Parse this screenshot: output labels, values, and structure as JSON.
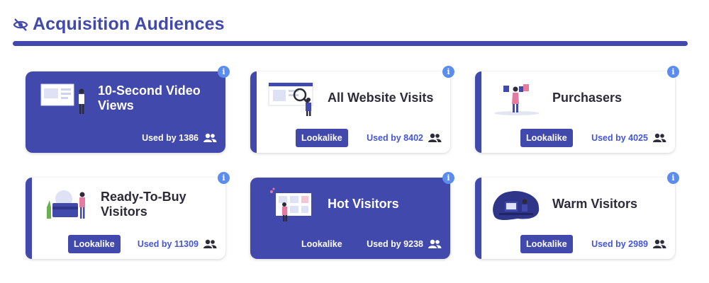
{
  "header": {
    "title": "Acquisition Audiences",
    "icon": "eye-slash-icon"
  },
  "colors": {
    "brand": "#4149ad",
    "accent": "#4455d6",
    "info": "#5b8df0"
  },
  "cards": [
    {
      "title": "10-Second Video Views",
      "lookalike": "",
      "used": "Used by 1386",
      "illustration": "video-views-illustration"
    },
    {
      "title": "All Website Visits",
      "lookalike": "Lookalike",
      "used": "Used by 8402",
      "illustration": "website-visits-illustration"
    },
    {
      "title": "Purchasers",
      "lookalike": "Lookalike",
      "used": "Used by 4025",
      "illustration": "purchasers-illustration"
    },
    {
      "title": "Ready-To-Buy Visitors",
      "lookalike": "Lookalike",
      "used": "Used by 11309",
      "illustration": "ready-to-buy-illustration"
    },
    {
      "title": "Hot Visitors",
      "lookalike": "Lookalike",
      "used": "Used by 9238",
      "illustration": "hot-visitors-illustration"
    },
    {
      "title": "Warm Visitors",
      "lookalike": "Lookalike",
      "used": "Used by 2989",
      "illustration": "warm-visitors-illustration"
    }
  ],
  "info_glyph": "i"
}
